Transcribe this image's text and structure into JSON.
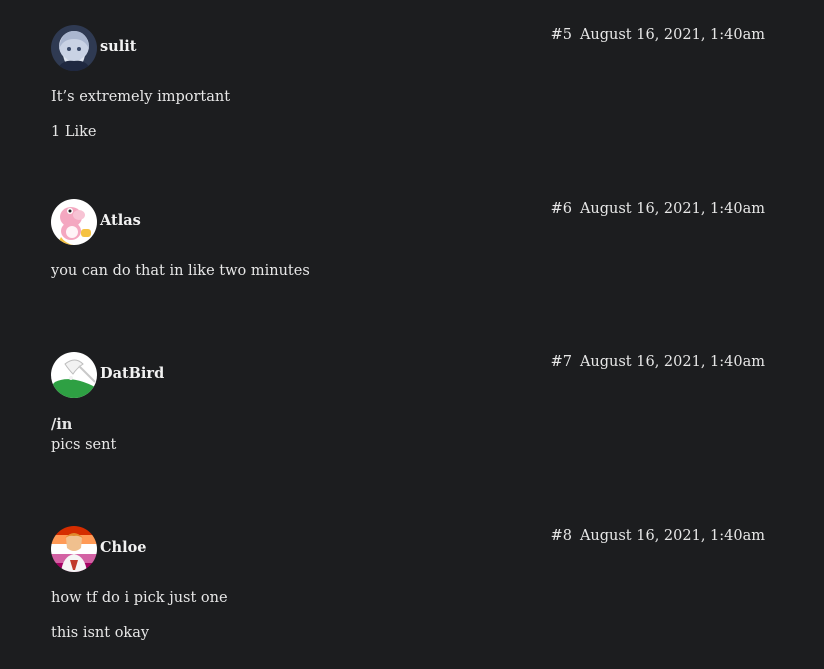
{
  "posts": [
    {
      "number": "#5",
      "date": "August 16, 2021, 1:40am",
      "username": "sulit",
      "avatar_icon": "anime-character-avatar-icon",
      "lines": [
        "It’s extremely important"
      ],
      "likes": "1 Like"
    },
    {
      "number": "#6",
      "date": "August 16, 2021, 1:40am",
      "username": "Atlas",
      "avatar_icon": "pink-yoshi-avatar-icon",
      "lines": [
        "you can do that in like two minutes"
      ]
    },
    {
      "number": "#7",
      "date": "August 16, 2021, 1:40am",
      "username": "DatBird",
      "avatar_icon": "green-bird-avatar-icon",
      "command": "/in",
      "lines": [
        "pics sent"
      ]
    },
    {
      "number": "#8",
      "date": "August 16, 2021, 1:40am",
      "username": "Chloe",
      "avatar_icon": "lesbian-flag-character-avatar-icon",
      "lines": [
        "how tf do i pick just one",
        "this isnt okay"
      ]
    }
  ],
  "colors": {
    "background": "#1c1d1f",
    "text": "#e7e7e7",
    "username": "#f2f2f2"
  }
}
